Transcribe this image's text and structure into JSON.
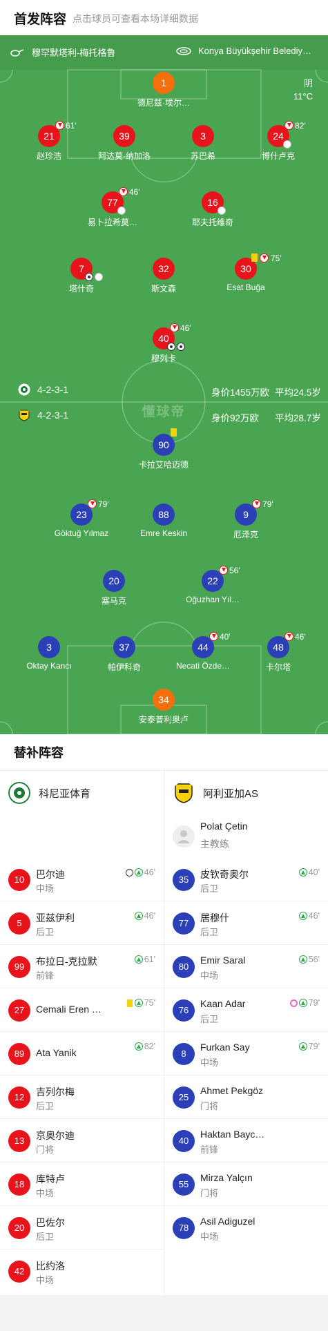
{
  "header": {
    "title": "首发阵容",
    "subtitle": "点击球员可查看本场详细数据"
  },
  "teams": {
    "home_name": "穆罕默塔利-梅托格鲁",
    "away_name": "Konya Büyükşehir Belediy…"
  },
  "weather": {
    "condition": "阴",
    "temperature": "11°C"
  },
  "watermark": "懂球帝",
  "home_summary": {
    "formation": "4-2-3-1",
    "value": "身价1455万欧",
    "avg_age": "平均24.5岁"
  },
  "away_summary": {
    "formation": "4-2-3-1",
    "value": "身价92万欧",
    "avg_age": "平均28.7岁"
  },
  "colors": {
    "home": "#e8141c",
    "away": "#2b3fb7",
    "goalkeeper": "#f5700d",
    "pitch": "#4aa552",
    "sub_in": "#27a843",
    "sub_out": "#e8141c",
    "yellow_card": "#f5d20c"
  },
  "home_players": [
    {
      "number": "1",
      "name": "德尼兹·埃尔…"
    },
    {
      "number": "21",
      "name": "赵珍浩",
      "sub_time": "61'"
    },
    {
      "number": "39",
      "name": "阿达莫-纳加洛"
    },
    {
      "number": "3",
      "name": "苏巴希"
    },
    {
      "number": "24",
      "name": "博什卢克",
      "sub_time": "82'"
    },
    {
      "number": "77",
      "name": "易卜拉希莫…",
      "sub_time": "46'"
    },
    {
      "number": "16",
      "name": "耶夫托维奇"
    },
    {
      "number": "7",
      "name": "塔什奇"
    },
    {
      "number": "32",
      "name": "斯文森"
    },
    {
      "number": "30",
      "name": "Esat Buğa",
      "sub_time": "75'"
    },
    {
      "number": "40",
      "name": "穆列卡",
      "sub_time": "46'"
    }
  ],
  "away_players": [
    {
      "number": "90",
      "name": "卡拉艾哈迈德"
    },
    {
      "number": "23",
      "name": "Göktuğ Yılmaz",
      "sub_time": "79'"
    },
    {
      "number": "88",
      "name": "Emre Keskin"
    },
    {
      "number": "9",
      "name": "厄泽克",
      "sub_time": "79'"
    },
    {
      "number": "20",
      "name": "塞马克"
    },
    {
      "number": "22",
      "name": "Oğuzhan Yıl…",
      "sub_time": "56'"
    },
    {
      "number": "3",
      "name": "Oktay Kancı"
    },
    {
      "number": "37",
      "name": "帕伊科奇"
    },
    {
      "number": "44",
      "name": "Necati Özde…",
      "sub_time": "40'"
    },
    {
      "number": "48",
      "name": "卡尔塔",
      "sub_time": "46'"
    },
    {
      "number": "34",
      "name": "安泰普利奥卢"
    }
  ],
  "subs": {
    "title": "替补阵容",
    "home_team": "科尼亚体育",
    "away_team": "阿利亚加AS",
    "coach": {
      "name": "Polat Çetin",
      "role": "主教练"
    },
    "home": [
      {
        "number": "10",
        "name": "巴尔迪",
        "role": "中场",
        "time": "46'"
      },
      {
        "number": "5",
        "name": "亚兹伊利",
        "role": "后卫",
        "time": "46'"
      },
      {
        "number": "99",
        "name": "布拉日-克拉默",
        "role": "前锋",
        "time": "61'"
      },
      {
        "number": "27",
        "name": "Cemali Eren …",
        "role": "",
        "time": "75'"
      },
      {
        "number": "89",
        "name": "Ata Yanik",
        "role": "",
        "time": "82'"
      },
      {
        "number": "12",
        "name": "吉列尔梅",
        "role": "后卫",
        "time": ""
      },
      {
        "number": "13",
        "name": "京奥尔迪",
        "role": "门将",
        "time": ""
      },
      {
        "number": "18",
        "name": "库特卢",
        "role": "中场",
        "time": ""
      },
      {
        "number": "20",
        "name": "巴佐尔",
        "role": "后卫",
        "time": ""
      },
      {
        "number": "42",
        "name": "比约洛",
        "role": "中场",
        "time": ""
      }
    ],
    "away": [
      {
        "number": "35",
        "name": "皮钦奇奥尔",
        "role": "后卫",
        "time": "40'"
      },
      {
        "number": "77",
        "name": "居穆什",
        "role": "后卫",
        "time": "46'"
      },
      {
        "number": "80",
        "name": "Emir Saral",
        "role": "中场",
        "time": "56'"
      },
      {
        "number": "76",
        "name": "Kaan Adar",
        "role": "后卫",
        "time": "79'"
      },
      {
        "number": "8",
        "name": "Furkan Say",
        "role": "中场",
        "time": "79'"
      },
      {
        "number": "25",
        "name": "Ahmet Pekgöz",
        "role": "门将",
        "time": ""
      },
      {
        "number": "40",
        "name": "Haktan Bayc…",
        "role": "前锋",
        "time": ""
      },
      {
        "number": "55",
        "name": "Mirza Yalçın",
        "role": "门将",
        "time": ""
      },
      {
        "number": "78",
        "name": "Asil Adiguzel",
        "role": "中场",
        "time": ""
      }
    ]
  }
}
